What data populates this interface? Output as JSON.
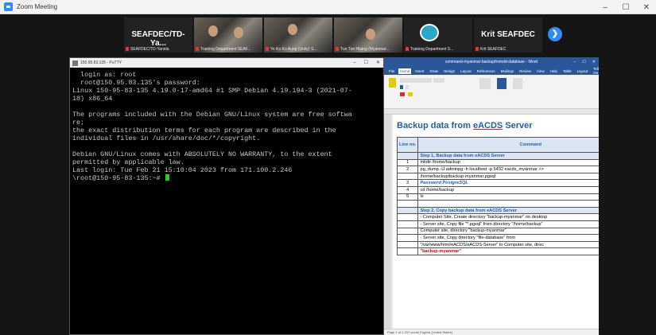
{
  "window": {
    "title": "Zoom Meeting",
    "controls": [
      "–",
      "☐",
      "✕"
    ]
  },
  "participants": [
    {
      "name": "SEAFDEC/TD-Ya...",
      "caption": "SEAFDEC/TD-Yanida",
      "type": "name"
    },
    {
      "name": "",
      "caption": "Training Department SEAF...",
      "type": "video"
    },
    {
      "name": "",
      "caption": "Ye Ko Ko Aung (Unity) S...",
      "type": "video"
    },
    {
      "name": "",
      "caption": "Tun Tun Hlaing (Myanmar...",
      "type": "video"
    },
    {
      "name": "",
      "caption": "Training Department S...",
      "type": "logo"
    },
    {
      "name": "Krit SEAFDEC",
      "caption": "Krit SEAFDEC",
      "type": "name"
    }
  ],
  "next_button": "❯",
  "putty": {
    "title": "150.95.83.135 - PuTTY",
    "controls": [
      "–",
      "☐",
      "✕"
    ],
    "lines": [
      "  login as: root",
      "  root@150.95.83.135's password:",
      "Linux 150-95-83-135 4.19.0-17-amd64 #1 SMP Debian 4.19.194-3 (2021-07-",
      "18) x86_64",
      "",
      "The programs included with the Debian GNU/Linux system are free softwa",
      "re;",
      "the exact distribution terms for each program are described in the",
      "individual files in /usr/share/doc/*/copyright.",
      "",
      "Debian GNU/Linux comes with ABSOLUTELY NO WARRANTY, to the extent",
      "permitted by applicable law.",
      "Last login: Tue Feb 21 15:10:04 2023 from 171.100.2.246",
      "\\root@150-95-83-135:~# "
    ]
  },
  "word": {
    "title": "command-myanmar-backupfromdd-database - Word",
    "tabs": [
      "File",
      "Home",
      "Insert",
      "Draw",
      "Design",
      "Layout",
      "References",
      "Mailings",
      "Review",
      "View",
      "Help",
      "Table",
      "Layout",
      "Tell me"
    ],
    "heading_prefix": "Backup data from ",
    "heading_underlined": "eACDS",
    "heading_suffix": " Server",
    "table": {
      "col_no": "Line no.",
      "col_cmd": "Command",
      "rows": [
        {
          "no": "",
          "cmd": "Step 1, Backup data from eACDS Server",
          "kind": "step"
        },
        {
          "no": "1",
          "cmd": "mkdir /home/backup",
          "kind": "cmd"
        },
        {
          "no": "2",
          "cmd": "pg_dump -U adminpg -h localhost -p 5432 eacds_myanmar >>",
          "kind": "cmd"
        },
        {
          "no": "",
          "cmd": "/home/backup/backup-myanmar.pgsql",
          "kind": "cmd"
        },
        {
          "no": "3",
          "cmd": "Password PostgreSQL",
          "kind": "pwd"
        },
        {
          "no": "4",
          "cmd": "cd /home/backup",
          "kind": "cmd"
        },
        {
          "no": "5",
          "cmd": "ls",
          "kind": "cmd"
        },
        {
          "no": "",
          "cmd": "",
          "kind": "cmd"
        },
        {
          "no": "",
          "cmd": "Step 2, Copy backup data from eACDS Server",
          "kind": "step"
        },
        {
          "no": "",
          "cmd": "- Computer Site, Create directory \"backup-myanmar\" on desktop",
          "kind": "cmd"
        },
        {
          "no": "",
          "cmd": "- Server site, Copy file \"*.pgsql\" from directory \"/home/backup\"",
          "kind": "cmd"
        },
        {
          "no": "",
          "cmd": "Computer site, directory \"backup-myanmar\"",
          "kind": "cmd"
        },
        {
          "no": "",
          "cmd": "- Server site, Copy directory \"file-database\" from",
          "kind": "cmd"
        },
        {
          "no": "",
          "cmd": "\"/var/www/html/eACDS/eACDS-Server\" to Computer site, direc",
          "kind": "cmd"
        },
        {
          "no": "",
          "cmd": "\"backup-myanmar\"",
          "kind": "red"
        }
      ]
    },
    "status": "Page 1 of 1     237 words     English (United States)"
  }
}
